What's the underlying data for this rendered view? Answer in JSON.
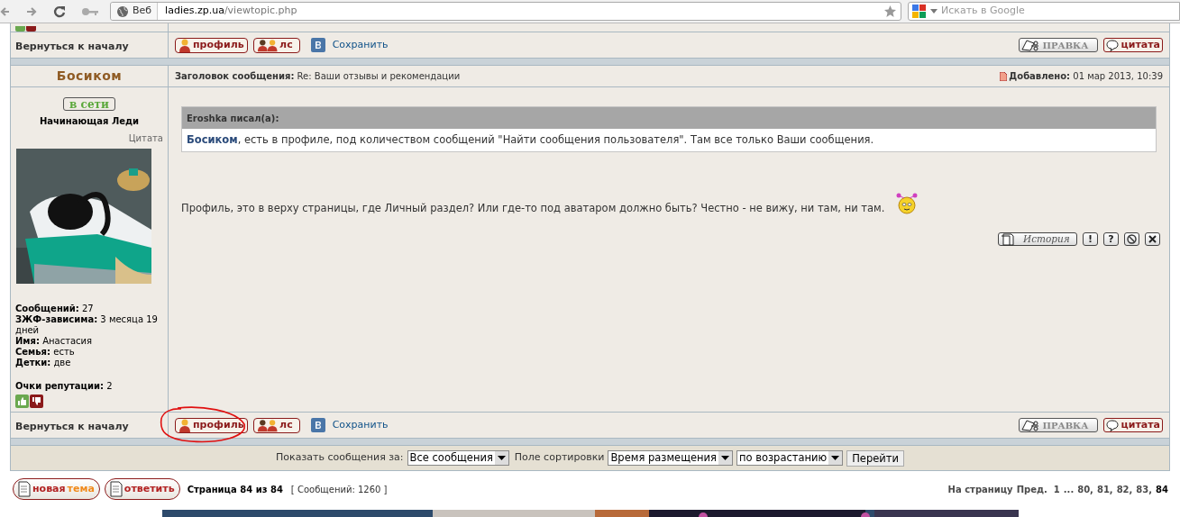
{
  "browser": {
    "site_label": "Веб",
    "url_host": "ladies.zp.ua",
    "url_path": "/viewtopic.php",
    "search_placeholder": "Искать в Google"
  },
  "top_footer": {
    "back_link": "Вернуться к началу",
    "profile_button": "профиль",
    "pm_button": "лс",
    "save_link": "Сохранить",
    "edit_button": "ПРАВКА",
    "quote_button": "цитата"
  },
  "post": {
    "author": "Босиком",
    "status": "в сети",
    "rank": "Начинающая Леди",
    "quote_link": "Цитата",
    "subject_label": "Заголовок сообщения:",
    "subject": "Re: Ваши отзывы и рекомендации",
    "added_label": "Добавлено:",
    "added": "01 мар 2013, 10:39",
    "stats": [
      {
        "label": "Сообщений:",
        "value": "27"
      },
      {
        "label": "ЗЖФ-зависима:",
        "value": "3 месяца 19 дней"
      },
      {
        "label": "Имя:",
        "value": "Анастасия"
      },
      {
        "label": "Семья:",
        "value": "есть"
      },
      {
        "label": "Детки:",
        "value": "две"
      }
    ],
    "reputation": {
      "label": "Очки репутации:",
      "value": "2"
    },
    "quote": {
      "header": "Eroshka писал(а):",
      "link": "Босиком",
      "text": ", есть в профиле, под количеством сообщений \"Найти сообщения пользователя\". Там все только Ваши сообщения."
    },
    "body": "Профиль, это в верху страницы, где Личный раздел? Или где-то под аватаром должно быть? Честно - не вижу, ни там, ни там.",
    "history_button": "История",
    "tool_buttons": [
      {
        "kind": "char",
        "label": "!"
      },
      {
        "kind": "char",
        "label": "?"
      },
      {
        "kind": "ban"
      },
      {
        "kind": "delete"
      }
    ]
  },
  "bottom_footer": {
    "back_link": "Вернуться к началу",
    "profile_button": "профиль",
    "pm_button": "лс",
    "save_link": "Сохранить",
    "edit_button": "ПРАВКА",
    "quote_button": "цитата"
  },
  "options": {
    "show_label": "Показать сообщения за:",
    "show_value": "Все сообщения",
    "sort_label": "Поле сортировки",
    "sort_value": "Время размещения",
    "order_value": "по возрастанию",
    "go_button": "Перейти"
  },
  "bottom_bar": {
    "new_topic": [
      "новая",
      "тема"
    ],
    "reply": "ответить",
    "page_info": "Страница 84 из 84",
    "posts_count": "[ Сообщений: 1260 ]",
    "pagination_label": "На страницу",
    "prev": "Пред.",
    "pages": [
      {
        "label": "1",
        "selected": false
      },
      {
        "label": "...",
        "selected": false
      },
      {
        "label": "80,",
        "selected": false
      },
      {
        "label": "81,",
        "selected": false
      },
      {
        "label": "82,",
        "selected": false
      },
      {
        "label": "83,",
        "selected": false
      },
      {
        "label": "84",
        "selected": true
      }
    ]
  }
}
